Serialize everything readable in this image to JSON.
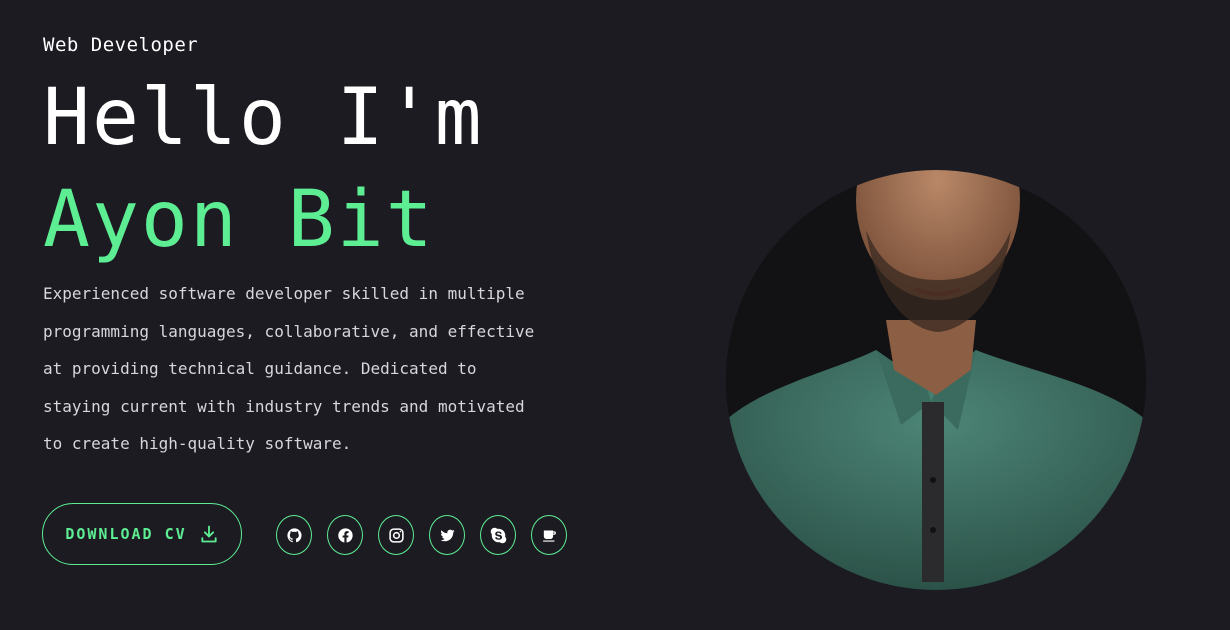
{
  "hero": {
    "role": "Web Developer",
    "greeting": "Hello I'm",
    "name": "Ayon Bit",
    "bio_lines": [
      "Experienced software developer skilled in multiple",
      "programming languages, collaborative, and effective",
      "at providing technical guidance. Dedicated to",
      "staying current with industry trends and motivated",
      "to create high-quality software."
    ],
    "download_label": "DOWNLOAD CV"
  },
  "socials": [
    "github-icon",
    "facebook-icon",
    "instagram-icon",
    "twitter-icon",
    "skype-icon",
    "coffee-icon"
  ],
  "colors": {
    "background": "#1c1b22",
    "accent": "#5ded93",
    "text": "#ffffff"
  }
}
